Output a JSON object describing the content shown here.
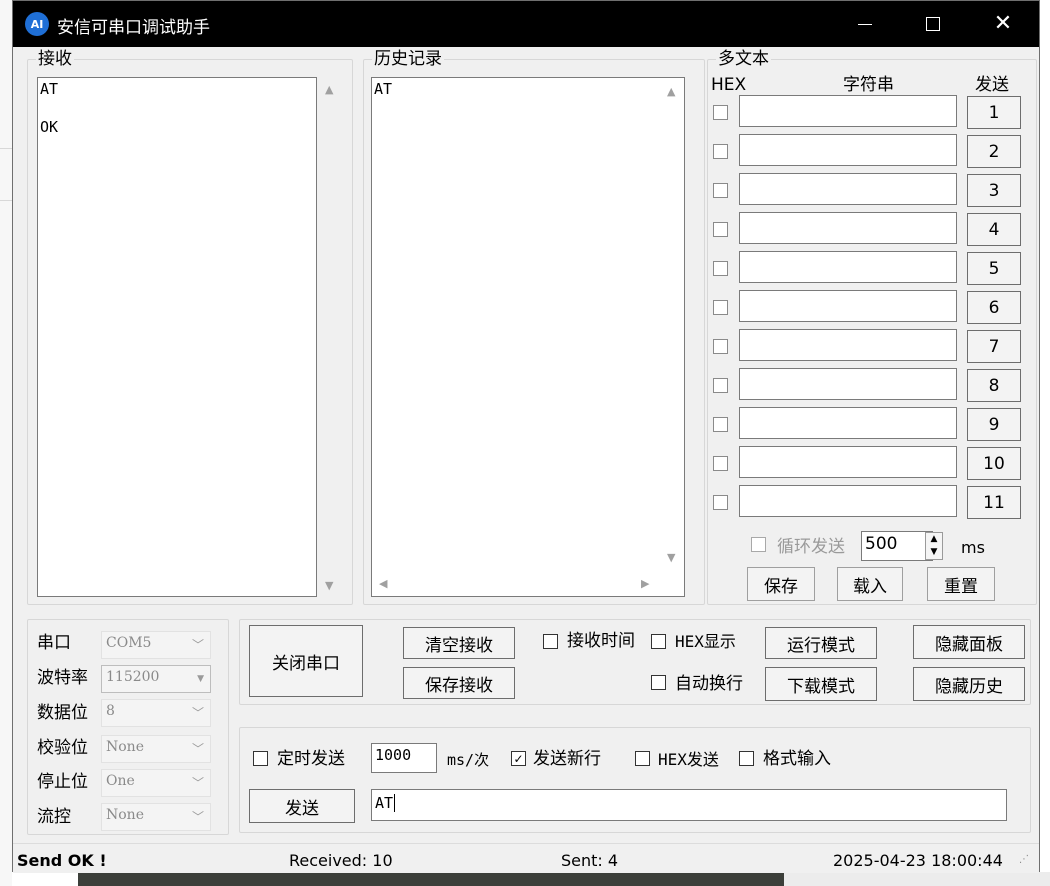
{
  "window": {
    "title": "安信可串口调试助手",
    "min_glyph": "—",
    "close_glyph": "✕",
    "icon_text": "AI"
  },
  "receive": {
    "label": "接收",
    "content": "AT\n\nOK"
  },
  "history": {
    "label": "历史记录",
    "content": "AT"
  },
  "multitext": {
    "label": "多文本",
    "hex_header": "HEX",
    "string_header": "字符串",
    "send_header": "发送",
    "rows": [
      {
        "num": "1"
      },
      {
        "num": "2"
      },
      {
        "num": "3"
      },
      {
        "num": "4"
      },
      {
        "num": "5"
      },
      {
        "num": "6"
      },
      {
        "num": "7"
      },
      {
        "num": "8"
      },
      {
        "num": "9"
      },
      {
        "num": "10"
      },
      {
        "num": "11"
      }
    ],
    "loop_send": "循环发送",
    "interval": "500",
    "interval_unit": "ms",
    "save": "保存",
    "load": "载入",
    "reset": "重置"
  },
  "port_settings": {
    "port": {
      "label": "串口",
      "value": "COM5"
    },
    "baud": {
      "label": "波特率",
      "value": "115200"
    },
    "databits": {
      "label": "数据位",
      "value": "8"
    },
    "parity": {
      "label": "校验位",
      "value": "None"
    },
    "stopbits": {
      "label": "停止位",
      "value": "One"
    },
    "flow": {
      "label": "流控",
      "value": "None"
    }
  },
  "controls": {
    "close_port": "关闭串口",
    "clear_receive": "清空接收",
    "save_receive": "保存接收",
    "receive_time": "接收时间",
    "hex_display": "HEX显示",
    "auto_newline": "自动换行",
    "run_mode": "运行模式",
    "download_mode": "下载模式",
    "hide_panel": "隐藏面板",
    "hide_history": "隐藏历史"
  },
  "send": {
    "timed_send": "定时发送",
    "timed_interval": "1000",
    "interval_unit": "ms/次",
    "send_newline": "发送新行",
    "send_newline_checked": true,
    "hex_send": "HEX发送",
    "format_input": "格式输入",
    "send_button": "发送",
    "send_text": "AT"
  },
  "status": {
    "message": "Send OK !",
    "received": "Received: 10",
    "sent": "Sent: 4",
    "datetime": "2025-04-23 18:00:44"
  }
}
